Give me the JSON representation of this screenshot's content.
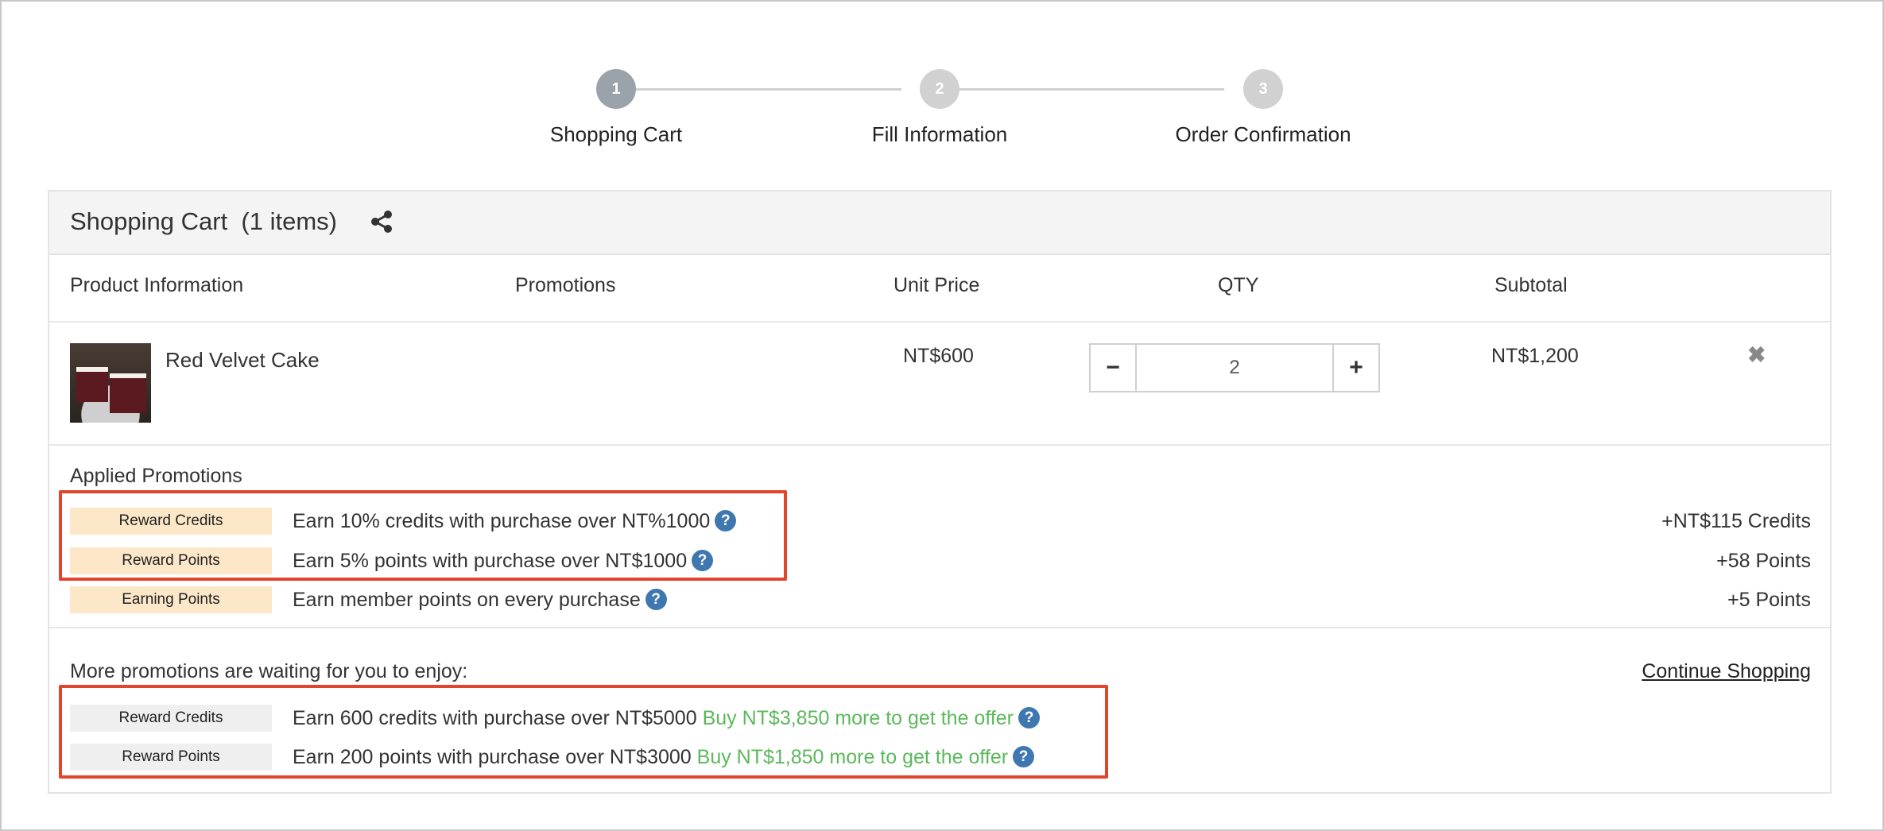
{
  "stepper": {
    "steps": [
      {
        "number": "1",
        "label": "Shopping Cart",
        "state": "active"
      },
      {
        "number": "2",
        "label": "Fill Information",
        "state": "inactive"
      },
      {
        "number": "3",
        "label": "Order Confirmation",
        "state": "inactive"
      }
    ]
  },
  "cart": {
    "title": "Shopping Cart",
    "item_count": "(1 items)",
    "share_icon": "share-icon",
    "columns": {
      "product": "Product Information",
      "promotions": "Promotions",
      "unit_price": "Unit Price",
      "qty": "QTY",
      "subtotal": "Subtotal"
    },
    "items": [
      {
        "name": "Red Velvet Cake",
        "unit_price": "NT$600",
        "qty": "2",
        "subtotal": "NT$1,200",
        "remove_icon": "✖",
        "decrement_icon": "−",
        "increment_icon": "+"
      }
    ]
  },
  "applied_promotions": {
    "title": "Applied Promotions",
    "items": [
      {
        "badge": "Reward Credits",
        "text": "Earn 10% credits with purchase over NT%1000",
        "value": "+NT$115 Credits"
      },
      {
        "badge": "Reward Points",
        "text": "Earn 5% points with purchase over NT$1000",
        "value": "+58 Points"
      },
      {
        "badge": "Earning Points",
        "text": "Earn member points on every purchase",
        "value": "+5 Points"
      }
    ]
  },
  "more_promotions": {
    "title": "More promotions are waiting for you to enjoy:",
    "continue_link": "Continue Shopping",
    "items": [
      {
        "badge": "Reward Credits",
        "text": "Earn 600 credits with purchase over NT$5000",
        "hint": "Buy NT$3,850 more to get the offer"
      },
      {
        "badge": "Reward Points",
        "text": "Earn 200 points with purchase over NT$3000",
        "hint": "Buy NT$1,850 more to get the offer"
      }
    ]
  },
  "help_icon_glyph": "?",
  "colors": {
    "badge_applied": "#fce8c8",
    "badge_more": "#efefef",
    "hint_green": "#5cb85c",
    "help_blue": "#3f78b0",
    "highlight_red": "#e2452c"
  }
}
